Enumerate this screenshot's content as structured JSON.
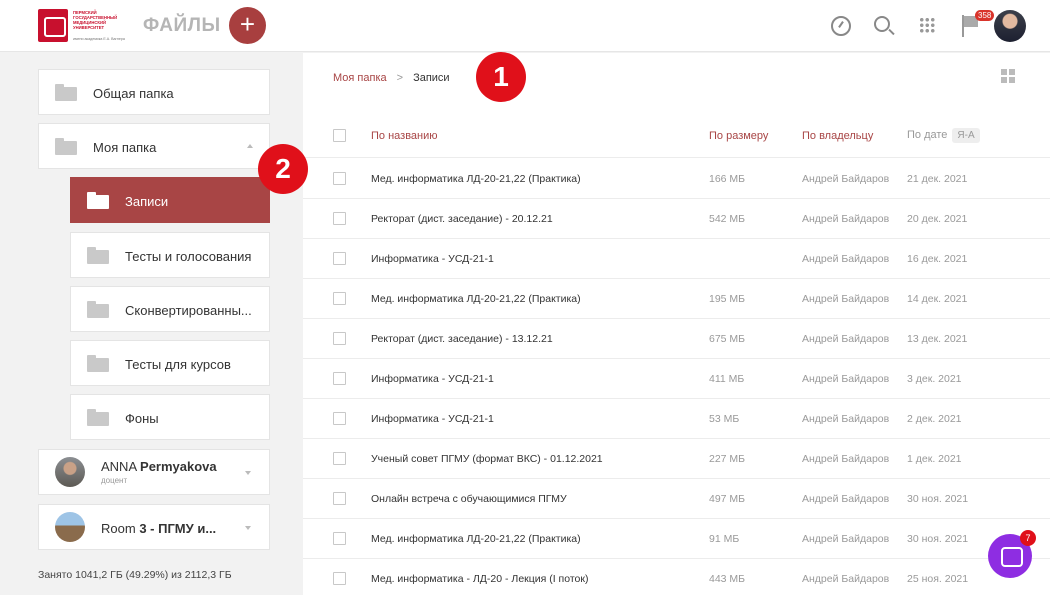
{
  "header": {
    "logo_text": "ПЕРМСКИЙ ГОСУДАРСТВЕННЫЙ МЕДИЦИНСКИЙ УНИВЕРСИТЕТ",
    "logo_sub": "имени академика Е.А. Вагнера",
    "title": "ФАЙЛЫ",
    "add_label": "+",
    "notifications_count": "358"
  },
  "sidebar": {
    "common_folder": "Общая папка",
    "my_folder": "Моя папка",
    "subfolders": [
      {
        "label": "Записи",
        "active": true
      },
      {
        "label": "Тесты и голосования",
        "active": false
      },
      {
        "label": "Сконвертированны...",
        "active": false
      },
      {
        "label": "Тесты для курсов",
        "active": false
      },
      {
        "label": "Фоны",
        "active": false
      }
    ],
    "users": [
      {
        "name_first": "ANNA",
        "name_last": "Permyakova",
        "role": "доцент"
      },
      {
        "name_first": "Room",
        "name_last": "3 - ПГМУ и...",
        "role": ""
      }
    ],
    "storage": "Занято 1041,2 ГБ (49.29%) из 2112,3 ГБ"
  },
  "breadcrumb": {
    "root": "Моя папка",
    "separator": ">",
    "current": "Записи"
  },
  "table": {
    "headers": {
      "name": "По названию",
      "size": "По размеру",
      "owner": "По владельцу",
      "date": "По дате",
      "sort": "Я-А"
    },
    "rows": [
      {
        "name": "Мед. информатика ЛД-20-21,22 (Практика)",
        "size": "166 МБ",
        "owner": "Андрей Байдаров",
        "date": "21 дек. 2021"
      },
      {
        "name": "Ректорат (дист. заседание) - 20.12.21",
        "size": "542 МБ",
        "owner": "Андрей Байдаров",
        "date": "20 дек. 2021"
      },
      {
        "name": "Информатика - УСД-21-1",
        "size": "",
        "owner": "Андрей Байдаров",
        "date": "16 дек. 2021"
      },
      {
        "name": "Мед. информатика ЛД-20-21,22 (Практика)",
        "size": "195 МБ",
        "owner": "Андрей Байдаров",
        "date": "14 дек. 2021"
      },
      {
        "name": "Ректорат (дист. заседание) - 13.12.21",
        "size": "675 МБ",
        "owner": "Андрей Байдаров",
        "date": "13 дек. 2021"
      },
      {
        "name": "Информатика - УСД-21-1",
        "size": "411 МБ",
        "owner": "Андрей Байдаров",
        "date": "3 дек. 2021"
      },
      {
        "name": "Информатика - УСД-21-1",
        "size": "53 МБ",
        "owner": "Андрей Байдаров",
        "date": "2 дек. 2021"
      },
      {
        "name": "Ученый совет ПГМУ (формат ВКС) - 01.12.2021",
        "size": "227 МБ",
        "owner": "Андрей Байдаров",
        "date": "1 дек. 2021"
      },
      {
        "name": "Онлайн встреча с обучающимися ПГМУ",
        "size": "497 МБ",
        "owner": "Андрей Байдаров",
        "date": "30 ноя. 2021"
      },
      {
        "name": "Мед. информатика ЛД-20-21,22 (Практика)",
        "size": "91 МБ",
        "owner": "Андрей Байдаров",
        "date": "30 ноя. 2021"
      },
      {
        "name": "Мед. информатика - ЛД-20 - Лекция (I поток)",
        "size": "443 МБ",
        "owner": "Андрей Байдаров",
        "date": "25 ноя. 2021"
      }
    ]
  },
  "callouts": [
    "1",
    "2"
  ],
  "chat_badge": "7",
  "colors": {
    "accent": "#a84545",
    "callout": "#e0101a",
    "chat": "#8e2de2"
  }
}
